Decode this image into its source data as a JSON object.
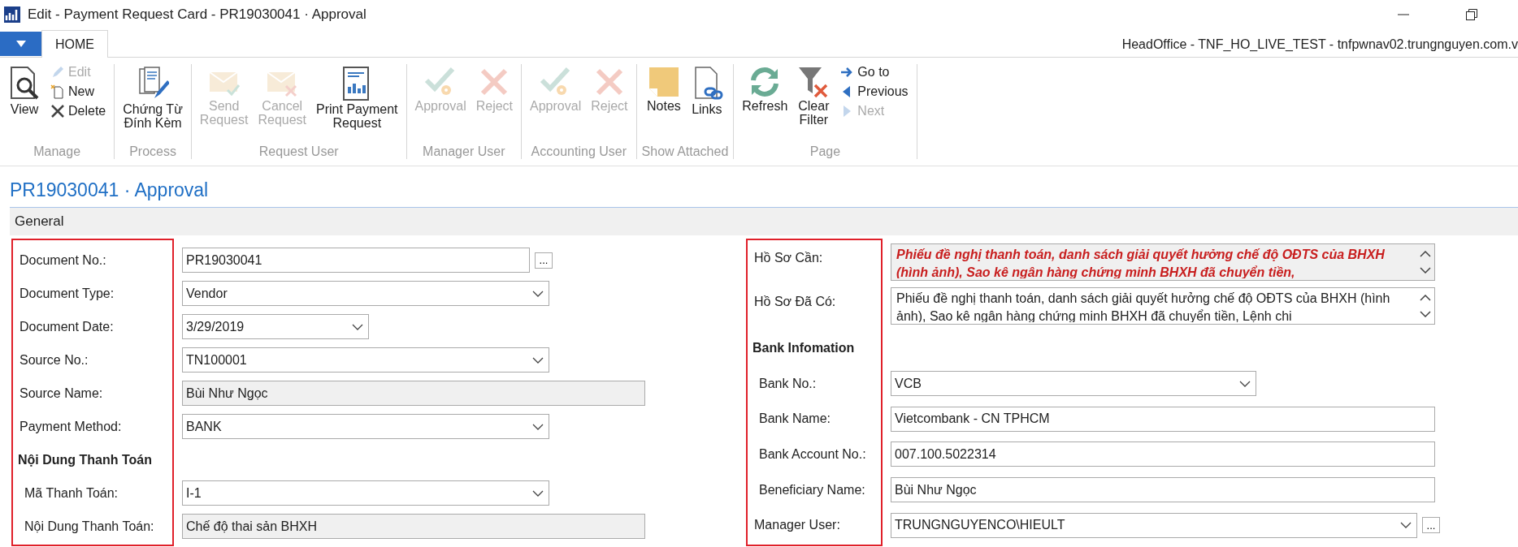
{
  "window": {
    "title": "Edit - Payment Request Card - PR19030041 · Approval"
  },
  "tabs": [
    {
      "label": "HOME",
      "selected": true
    }
  ],
  "connection": "HeadOffice - TNF_HO_LIVE_TEST - tnfpwnav02.trungnguyen.com.v",
  "ribbon": [
    {
      "label": "Manage",
      "buttons": [
        {
          "label": "View",
          "kind": "large",
          "disabled": false
        },
        {
          "label": "Edit",
          "kind": "small",
          "disabled": true
        },
        {
          "label": "New",
          "kind": "small",
          "disabled": false
        },
        {
          "label": "Delete",
          "kind": "small",
          "disabled": false
        }
      ]
    },
    {
      "label": "Process",
      "buttons": [
        {
          "label": "Chứng Từ\nĐính Kèm",
          "kind": "large",
          "disabled": false
        }
      ]
    },
    {
      "label": "Request User",
      "buttons": [
        {
          "label": "Send\nRequest",
          "kind": "large",
          "disabled": true
        },
        {
          "label": "Cancel\nRequest",
          "kind": "large",
          "disabled": true
        },
        {
          "label": "Print Payment\nRequest",
          "kind": "large",
          "disabled": false
        }
      ]
    },
    {
      "label": "Manager User",
      "buttons": [
        {
          "label": "Approval",
          "kind": "large",
          "disabled": true
        },
        {
          "label": "Reject",
          "kind": "large",
          "disabled": true
        }
      ]
    },
    {
      "label": "Accounting User",
      "buttons": [
        {
          "label": "Approval",
          "kind": "large",
          "disabled": true
        },
        {
          "label": "Reject",
          "kind": "large",
          "disabled": true
        }
      ]
    },
    {
      "label": "Show Attached",
      "buttons": [
        {
          "label": "Notes",
          "kind": "large",
          "disabled": false
        },
        {
          "label": "Links",
          "kind": "large",
          "disabled": false
        }
      ]
    },
    {
      "label": "Page",
      "buttons": [
        {
          "label": "Refresh",
          "kind": "large",
          "disabled": false
        },
        {
          "label": "Clear\nFilter",
          "kind": "large",
          "disabled": false
        },
        {
          "label": "Go to",
          "kind": "small",
          "disabled": false
        },
        {
          "label": "Previous",
          "kind": "small",
          "disabled": false
        },
        {
          "label": "Next",
          "kind": "small",
          "disabled": true
        }
      ]
    }
  ],
  "page_title": "PR19030041 · Approval",
  "section": {
    "title": "General",
    "left": [
      {
        "label": "Document No.:",
        "value": "PR19030041",
        "kind": "lookup",
        "button": "..."
      },
      {
        "label": "Document Type:",
        "value": "Vendor",
        "kind": "dropdown"
      },
      {
        "label": "Document Date:",
        "value": "3/29/2019",
        "kind": "date"
      },
      {
        "label": "Source No.:",
        "value": "TN100001",
        "kind": "dropdown"
      },
      {
        "label": "Source Name:",
        "value": "Bùi Như Ngọc",
        "kind": "readonly"
      },
      {
        "label": "Payment Method:",
        "value": "BANK",
        "kind": "dropdown"
      },
      {
        "label": "Nội Dung Thanh Toán",
        "kind": "group",
        "children": [
          {
            "label": "Mã Thanh Toán:",
            "value": "I-1",
            "kind": "dropdown"
          },
          {
            "label": "Nội Dung Thanh Toán:",
            "value": "Chế độ thai sản BHXH",
            "kind": "readonly"
          }
        ]
      }
    ],
    "right": [
      {
        "label": "Hồ Sơ Cần:",
        "value": "Phiếu đề nghị thanh toán, danh sách giải quyết hưởng chế độ OĐTS của BHXH (hình ảnh), Sao kê ngân hàng chứng minh BHXH đã chuyển tiền,",
        "kind": "memo",
        "emphasis": true
      },
      {
        "label": "Hồ Sơ Đã Có:",
        "value": "Phiếu đề nghị thanh toán, danh sách giải quyết hưởng chế độ OĐTS của BHXH (hình ảnh), Sao kê ngân hàng chứng minh BHXH đã chuyển tiền, Lệnh chi",
        "kind": "memo",
        "emphasis": false
      },
      {
        "label": "Bank Infomation",
        "kind": "group",
        "children": [
          {
            "label": "Bank No.:",
            "value": "VCB",
            "kind": "dropdown"
          },
          {
            "label": "Bank Name:",
            "value": "Vietcombank - CN TPHCM",
            "kind": "text"
          },
          {
            "label": "Bank Account No.:",
            "value": "007.100.5022314",
            "kind": "text"
          },
          {
            "label": "Beneficiary Name:",
            "value": "Bùi Như Ngọc",
            "kind": "text"
          }
        ]
      },
      {
        "label": "Manager User:",
        "value": "TRUNGNGUYENCO\\HIEULT",
        "kind": "lookup-dropdown",
        "button": "..."
      }
    ]
  }
}
